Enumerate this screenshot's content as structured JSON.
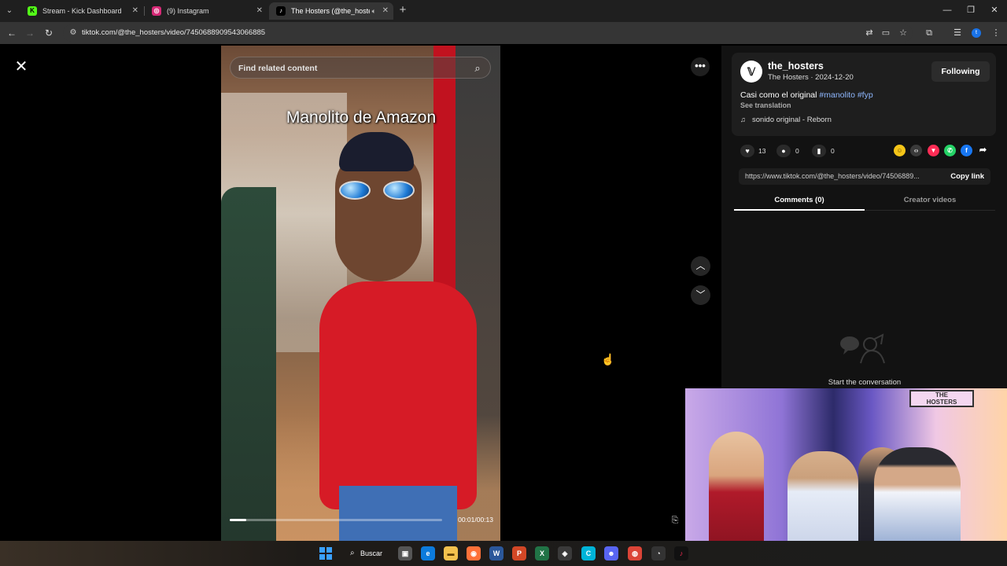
{
  "browser": {
    "tabs": [
      {
        "title": "Stream - Kick Dashboard",
        "icon": "kick-icon",
        "active": false
      },
      {
        "title": "(9) Instagram",
        "icon": "instagram-icon",
        "active": false
      },
      {
        "title": "The Hosters (@the_hosters",
        "icon": "tiktok-icon",
        "active": true
      }
    ],
    "url": "tiktok.com/@the_hosters/video/7450688909543066885"
  },
  "video": {
    "search_placeholder": "Find related content",
    "overlay_text": "Manolito de Amazon",
    "time": "00:01/00:13",
    "progress": 0.077
  },
  "post": {
    "username": "the_hosters",
    "display_name_date": "The Hosters · 2024-12-20",
    "follow_label": "Following",
    "description": "Casi como el original ",
    "hashtags": "#manolito #fyp",
    "see_translation": "See translation",
    "music": "sonido original - Reborn",
    "likes": "13",
    "comments": "0",
    "saves": "0",
    "link": "https://www.tiktok.com/@the_hosters/video/74506889...",
    "copy_link": "Copy link"
  },
  "tabs": {
    "comments": "Comments (0)",
    "creator_videos": "Creator videos"
  },
  "empty_state": "Start the conversation",
  "webcam": {
    "sign_text": "THE\nHOSTERS"
  },
  "taskbar": {
    "search_label": "Buscar"
  },
  "colors": {
    "tiktok_red": "#fe2c55",
    "hashtag_blue": "#8fb8ff",
    "accent_blue": "#1a73e8"
  }
}
